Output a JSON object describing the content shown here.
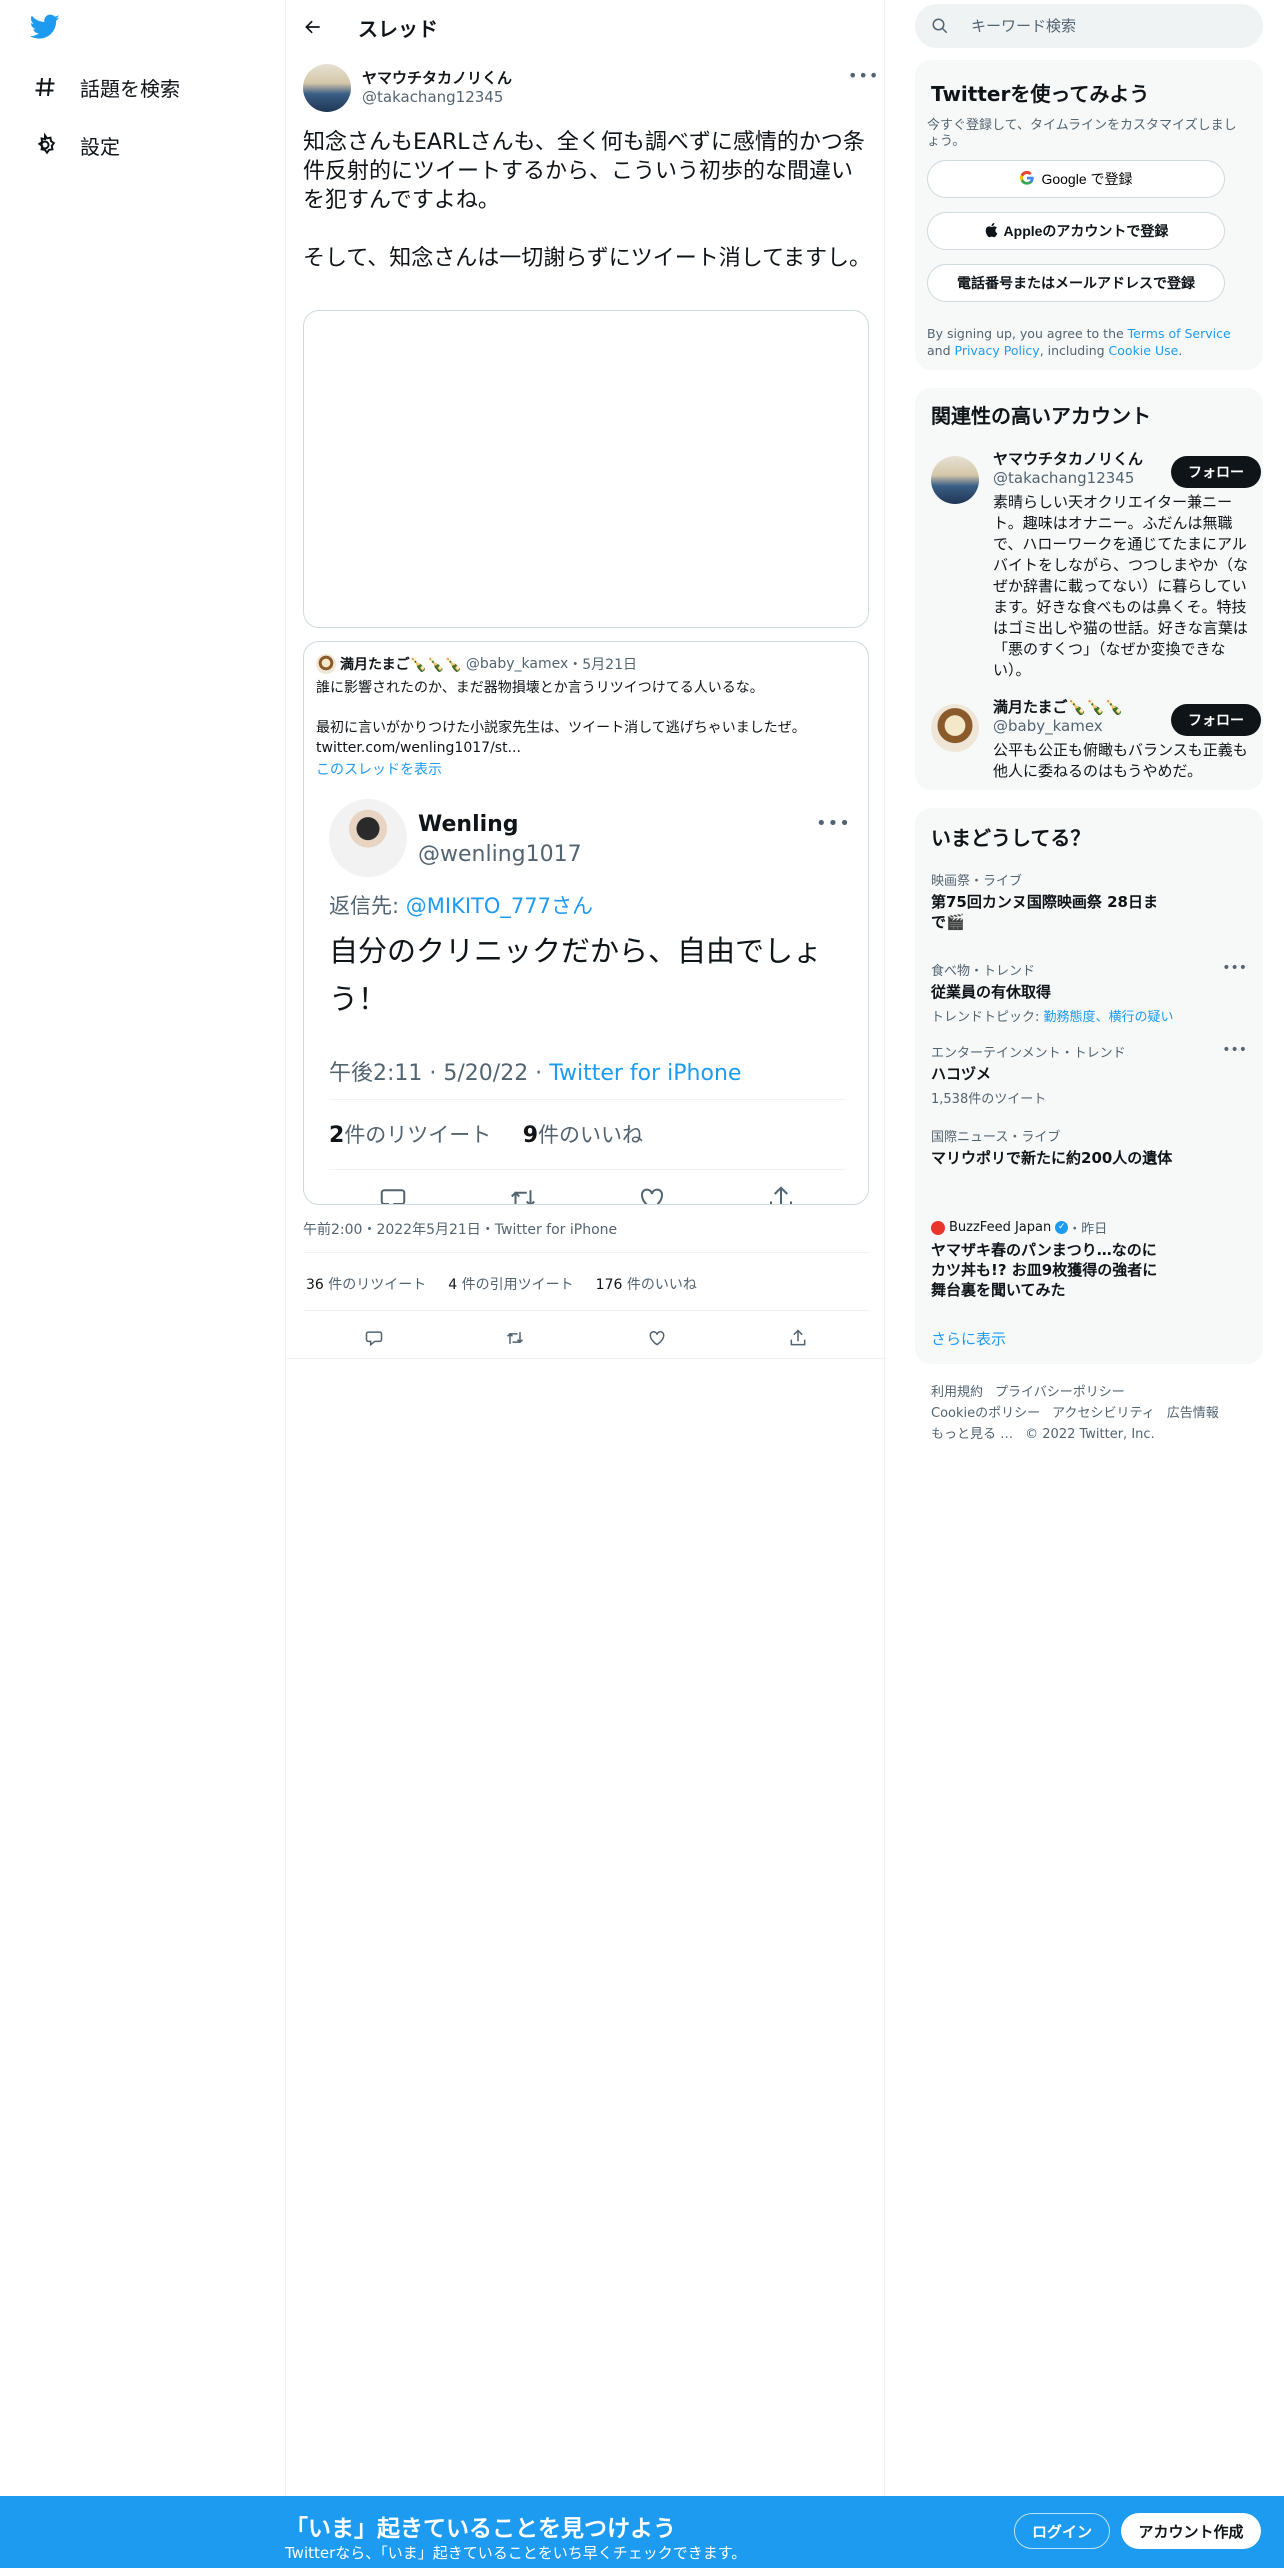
{
  "nav": {
    "explore_label": "話題を検索",
    "settings_label": "設定"
  },
  "header": {
    "title": "スレッド"
  },
  "tweet": {
    "author_name": "ヤマウチタカノリくん",
    "author_handle": "@takachang12345",
    "text_p1": "知念さんもEARLさんも、全く何も調べずに感情的かつ条件反射的にツイートするから、こういう初歩的な間違いを犯すんですよね。",
    "text_p2": "そして、知念さんは一切謝らずにツイート消してますし。",
    "meta": "午前2:00・2022年5月21日・Twitter for iPhone",
    "retweets_count": "36",
    "retweets_label": "件のリツイート",
    "quotes_count": "4",
    "quotes_label": "件の引用ツイート",
    "likes_count": "176",
    "likes_label": "件のいいね"
  },
  "quote": {
    "author_name": "満月たまご🍾🍾🍾",
    "author_handle": "@baby_kamex",
    "date": "・5月21日",
    "text_p1": "誰に影響されたのか、まだ器物損壊とか言うリツイつけてる人いるな。",
    "text_p2": "最初に言いがかりつけた小説家先生は、ツイート消して逃げちゃいましたぜ。",
    "text_link": "twitter.com/wenling1017/st...",
    "show_thread": "このスレッドを表示",
    "embed": {
      "name": "Wenling",
      "handle": "@wenling1017",
      "reply_prefix": "返信先: ",
      "reply_to": "@MIKITO_777さん",
      "text": "自分のクリニックだから、自由でしょう！",
      "time": "午後2:11 · 5/20/22 · ",
      "source": "Twitter for iPhone",
      "retweets_count": "2",
      "retweets_label": "件のリツイート",
      "likes_count": "9",
      "likes_label": "件のいいね"
    }
  },
  "search": {
    "placeholder": "キーワード検索"
  },
  "signup": {
    "title": "Twitterを使ってみよう",
    "subtitle": "今すぐ登録して、タイムラインをカスタマイズしましょう。",
    "google_label": "Google で登録",
    "apple_label": "Appleのアカウントで登録",
    "phone_label": "電話番号またはメールアドレスで登録",
    "tos_pre": "By signing up, you agree to the ",
    "tos_terms": "Terms of Service",
    "tos_and": " and ",
    "tos_privacy": "Privacy Policy",
    "tos_mid": ", including ",
    "tos_cookie": "Cookie Use",
    "tos_end": "."
  },
  "related": {
    "title": "関連性の高いアカウント",
    "accounts": [
      {
        "name": "ヤマウチタカノリくん",
        "handle": "@takachang12345",
        "bio": "素晴らしい天オクリエイター兼ニート。趣味はオナニー。ふだんは無職で、ハローワークを通じてたまにアルバイトをしながら、つつしまやか（なぜか辞書に載ってない）に暮らしています。好きな食べものは鼻くそ。特技はゴミ出しや猫の世話。好きな言葉は「悪のすくつ」（なぜか変換できない）。",
        "follow_label": "フォロー"
      },
      {
        "name": "満月たまご🍾🍾🍾",
        "handle": "@baby_kamex",
        "bio": "公平も公正も俯瞰もバランスも正義も他人に委ねるのはもうやめだ。",
        "follow_label": "フォロー"
      }
    ]
  },
  "trends": {
    "title": "いまどうしてる？",
    "items": [
      {
        "category": "映画祭・ライブ",
        "name": "第75回カンヌ国際映画祭 28日まで🎬",
        "sub": ""
      },
      {
        "category": "食べ物・トレンド",
        "name": "従業員の有休取得",
        "sub_prefix": "トレンドトピック: ",
        "sub_links": "勤務態度、横行の疑い"
      },
      {
        "category": "エンターテインメント・トレンド",
        "name": "ハコヅメ",
        "sub": "1,538件のツイート"
      },
      {
        "category": "国際ニュース・ライブ",
        "name": "マリウポリで新たに約200人の遺体",
        "sub": ""
      },
      {
        "category": "BuzzFeed Japan",
        "category_suffix": "・昨日",
        "name": "ヤマザキ春のパンまつり…なのにカツ丼も!? お皿9枚獲得の強者に舞台裏を聞いてみた",
        "sub": ""
      }
    ],
    "show_more": "さらに表示"
  },
  "footer": {
    "links": [
      "利用規約",
      "プライバシーポリシー",
      "Cookieのポリシー",
      "アクセシビリティ",
      "広告情報",
      "もっと見る …",
      "© 2022 Twitter, Inc."
    ]
  },
  "bottom": {
    "title": "「いま」起きていることを見つけよう",
    "subtitle": "Twitterなら、「いま」起きていることをいち早くチェックできます。",
    "login_label": "ログイン",
    "signup_label": "アカウント作成"
  },
  "colors": {
    "accent": "#1d9bf0",
    "text": "#0f1419",
    "secondary": "#536471",
    "border": "#cfd9de"
  }
}
